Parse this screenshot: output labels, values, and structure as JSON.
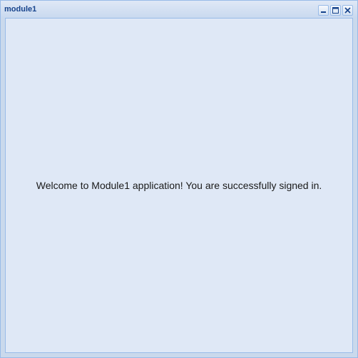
{
  "window": {
    "title": "module1",
    "tools": [
      {
        "name": "minimize",
        "icon": "minimize-icon"
      },
      {
        "name": "maximize",
        "icon": "maximize-icon"
      },
      {
        "name": "close",
        "icon": "close-icon"
      }
    ]
  },
  "content": {
    "message": "Welcome to Module1 application! You are successfully signed in."
  },
  "colors": {
    "title_text": "#15428b",
    "border": "#99bbe8",
    "body_background": "#dfe8f6",
    "message_text": "#1a1a1a"
  }
}
